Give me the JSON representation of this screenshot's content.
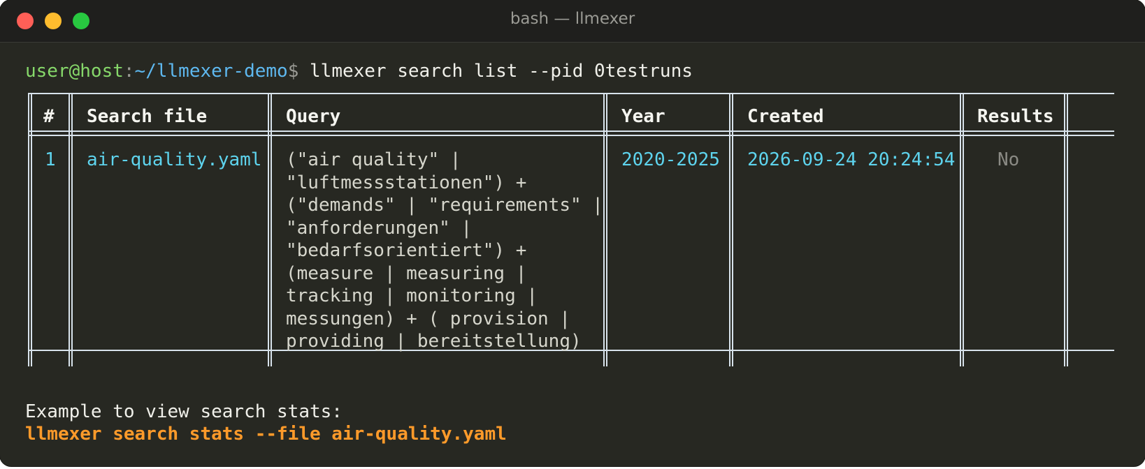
{
  "window": {
    "title": "bash — llmexer"
  },
  "prompt": {
    "user_host": "user@host",
    "separator": ":",
    "path": "~/llmexer-demo",
    "symbol": "$",
    "command": " llmexer search list --pid 0testruns"
  },
  "table": {
    "headers": [
      "#",
      "Search file",
      "Query",
      "Year",
      "Created",
      "Results"
    ],
    "rows": [
      {
        "index": "1",
        "search_file": "air-quality.yaml",
        "query": "(\"air quality\" |\n\"luftmessstationen\") +\n(\"demands\" | \"requirements\" |\n\"anforderungen\" |\n\"bedarfsorientiert\") +\n(measure | measuring |\ntracking | monitoring |\nmessungen) + ( provision |\nproviding | bereitstellung)",
        "year": "2020-2025",
        "created": "2026-09-24 20:24:54",
        "results": "No"
      }
    ]
  },
  "hint": {
    "text": "Example to view search stats:",
    "command": "llmexer search stats --file air-quality.yaml"
  },
  "colors": {
    "background": "#272822",
    "prompt_user": "#86d86a",
    "prompt_path": "#5eb8ef",
    "cyan_value": "#5ed4ee",
    "hint_command": "#fd9a2a"
  }
}
